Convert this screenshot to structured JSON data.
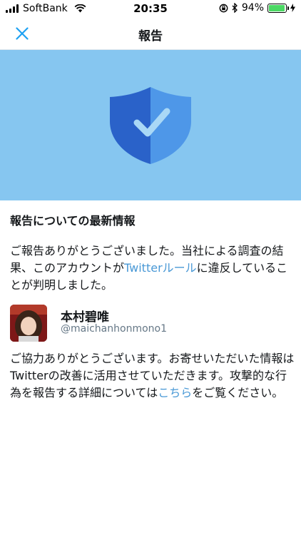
{
  "status_bar": {
    "carrier": "SoftBank",
    "time": "20:35",
    "battery_percent": "94%",
    "battery_level": 0.94
  },
  "nav": {
    "title": "報告"
  },
  "report": {
    "heading": "報告についての最新情報",
    "para1_part1": "ご報告ありがとうございました。当社による調査の結果、このアカウントが",
    "rules_link": "Twitterルール",
    "para1_part2": "に違反していることが判明しました。"
  },
  "account": {
    "name": "本村碧唯",
    "handle": "@maichanhonmono1"
  },
  "thanks": {
    "part1": "ご協力ありがとうございます。お寄せいただいた情報はTwitterの改善に活用させていただきます。攻撃的な行為を報告する詳細については",
    "link": "こちら",
    "part2": "をご覧ください。"
  },
  "colors": {
    "hero_bg": "#86c6f0",
    "link": "#4a99d6",
    "shield_dark": "#2a62c9",
    "shield_light": "#4e97e8"
  },
  "icons": {
    "close": "close-icon",
    "shield": "shield-check-icon"
  }
}
